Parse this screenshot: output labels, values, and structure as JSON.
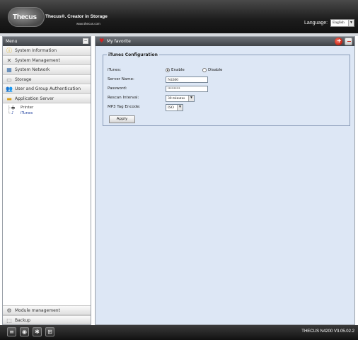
{
  "header": {
    "logo": "Thecus",
    "tagline": "Thecus®. Creator in Storage",
    "website": "www.thecus.com",
    "language_label": "Language:",
    "language_value": "English"
  },
  "sidebar": {
    "title": "Menu",
    "categories": [
      {
        "label": "System Information",
        "icon": "info-icon"
      },
      {
        "label": "System Management",
        "icon": "tools-icon"
      },
      {
        "label": "System Network",
        "icon": "network-icon"
      },
      {
        "label": "Storage",
        "icon": "storage-icon"
      },
      {
        "label": "User and Group Authentication",
        "icon": "users-icon"
      },
      {
        "label": "Application Server",
        "icon": "folder-icon"
      }
    ],
    "sub_items": [
      {
        "label": "Printer",
        "icon": "printer-icon"
      },
      {
        "label": "iTunes",
        "icon": "music-icon"
      }
    ],
    "bottom_categories": [
      {
        "label": "Module management",
        "icon": "module-icon"
      },
      {
        "label": "Backup",
        "icon": "backup-icon"
      }
    ]
  },
  "main": {
    "favorite_label": "My favorite",
    "form": {
      "legend": "iTunes Configuration",
      "itunes_label": "iTunes:",
      "enable_label": "Enable",
      "disable_label": "Disable",
      "server_name_label": "Server Name:",
      "server_name_value": "N4300",
      "password_label": "Password:",
      "password_value": "••••••••••",
      "rescan_label": "Rescan Interval:",
      "rescan_value": "30 minutes",
      "mp3_label": "MP3 Tag Encode:",
      "mp3_value": "ISO",
      "apply_label": "Apply"
    }
  },
  "footer": {
    "version": "THECUS N4200 V3.05.02.2"
  }
}
